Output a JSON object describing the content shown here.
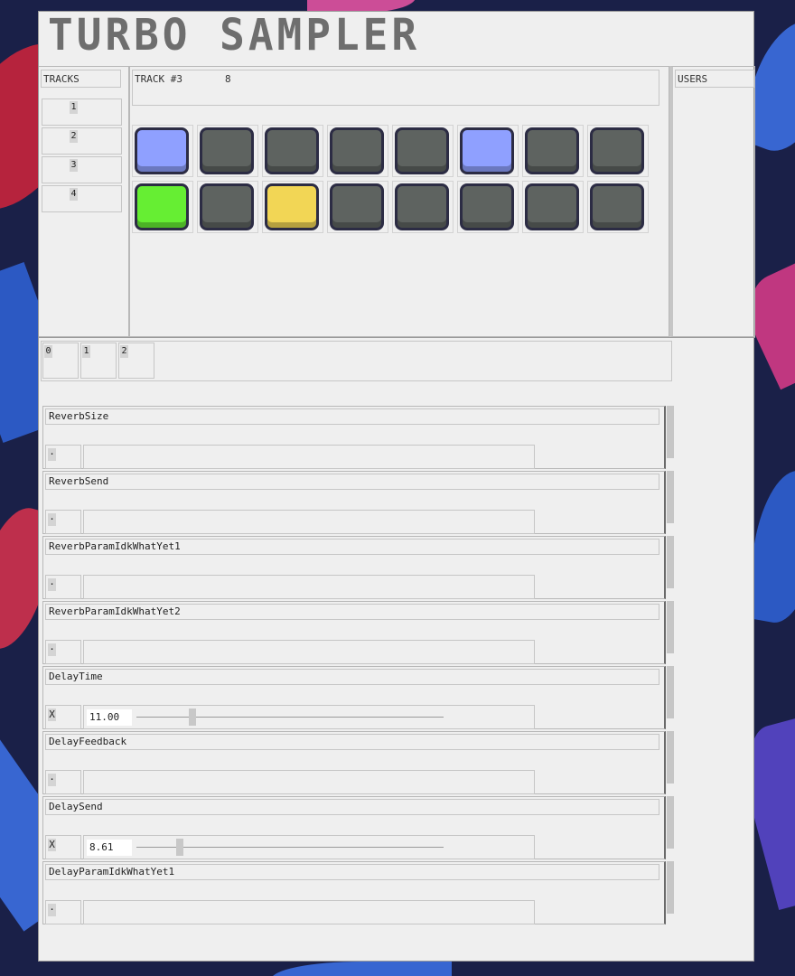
{
  "app": {
    "title": "TURBO SAMPLER"
  },
  "colors": {
    "pad_off": "#5e6360",
    "pad_blue": "#8fa0ff",
    "pad_green": "#66ee33",
    "pad_yellow": "#f2d655",
    "panel_bg": "#efefef"
  },
  "tracks": {
    "header": "TRACKS",
    "items": [
      "1",
      "2",
      "3",
      "4"
    ]
  },
  "track_view": {
    "name": "TRACK #3",
    "value": "8",
    "pads_row1": [
      "blue",
      "off",
      "off",
      "off",
      "off",
      "blue",
      "off",
      "off"
    ],
    "pads_row2": [
      "green",
      "off",
      "yellow",
      "off",
      "off",
      "off",
      "off",
      "off"
    ]
  },
  "users": {
    "header": "USERS"
  },
  "tabs": [
    "0",
    "1",
    "2"
  ],
  "params": [
    {
      "name": "ReverbSize",
      "toggle": "·",
      "value": "",
      "slider": null
    },
    {
      "name": "ReverbSend",
      "toggle": "·",
      "value": "",
      "slider": null
    },
    {
      "name": "ReverbParamIdkWhatYet1",
      "toggle": "·",
      "value": "",
      "slider": null
    },
    {
      "name": "ReverbParamIdkWhatYet2",
      "toggle": "·",
      "value": "",
      "slider": null
    },
    {
      "name": "DelayTime",
      "toggle": "X",
      "value": "11.00",
      "slider": 0.17
    },
    {
      "name": "DelayFeedback",
      "toggle": "·",
      "value": "",
      "slider": null
    },
    {
      "name": "DelaySend",
      "toggle": "X",
      "value": "8.61",
      "slider": 0.13
    },
    {
      "name": "DelayParamIdkWhatYet1",
      "toggle": "·",
      "value": "",
      "slider": null
    }
  ]
}
